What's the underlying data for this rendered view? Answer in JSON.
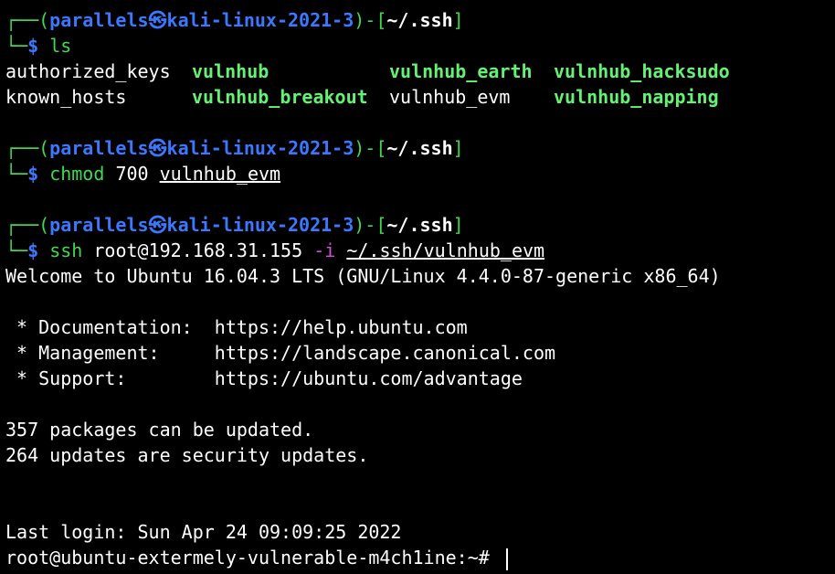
{
  "prompts": [
    {
      "user": "parallels",
      "sep": "㉿",
      "host": "kali-linux-2021-3",
      "path": "~/.ssh",
      "cmd": "ls",
      "args": []
    },
    {
      "user": "parallels",
      "sep": "㉿",
      "host": "kali-linux-2021-3",
      "path": "~/.ssh",
      "cmd": "chmod",
      "args": [
        "700",
        "vulnhub_evm"
      ]
    },
    {
      "user": "parallels",
      "sep": "㉿",
      "host": "kali-linux-2021-3",
      "path": "~/.ssh",
      "cmd": "ssh",
      "args": [
        "root@192.168.31.155",
        "-i",
        "~/.ssh/vulnhub_evm"
      ]
    }
  ],
  "ls_output": {
    "row1": [
      "authorized_keys",
      "vulnhub",
      "vulnhub_earth",
      "vulnhub_hacksudo"
    ],
    "row2": [
      "known_hosts",
      "vulnhub_breakout",
      "vulnhub_evm",
      "vulnhub_napping"
    ]
  },
  "ssh_output": {
    "welcome": "Welcome to Ubuntu 16.04.3 LTS (GNU/Linux 4.4.0-87-generic x86_64)",
    "docs": " * Documentation:  https://help.ubuntu.com",
    "mgmt": " * Management:     https://landscape.canonical.com",
    "support": " * Support:        https://ubuntu.com/advantage",
    "packages": "357 packages can be updated.",
    "security": "264 updates are security updates.",
    "last_login": "Last login: Sun Apr 24 09:09:25 2022",
    "remote_prompt": "root@ubuntu-extermely-vulnerable-m4ch1ine:~# "
  },
  "colors": {
    "background": "#000000",
    "prompt_frame": "#3fd94f",
    "user_host": "#3b78ff",
    "executable_file": "#64f274",
    "flag": "#d34fd6"
  }
}
